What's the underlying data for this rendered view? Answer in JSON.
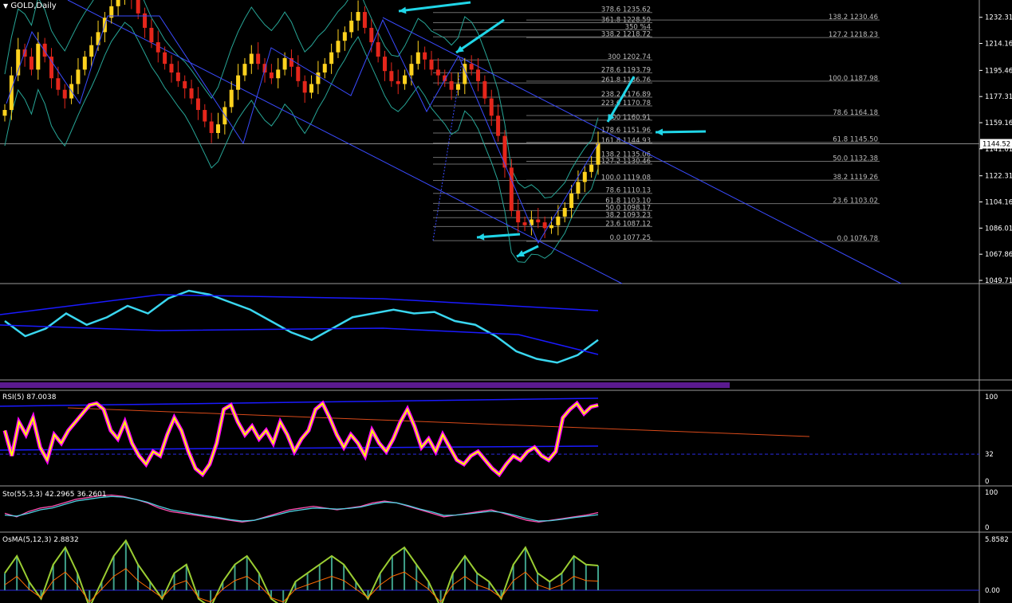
{
  "window": {
    "title": "GOLD,Daily",
    "menu_icon": "triangle-down-icon"
  },
  "colors": {
    "background": "#000000",
    "bull_candle": "#ffd21e",
    "bear_candle": "#e5261b",
    "bollinger": "#27a596",
    "trendline": "#3a4bff",
    "arrow": "#20d6e8",
    "fib_line": "#6e6e6e",
    "rsi_main": "#ffff00",
    "rsi_glow": "#ff00ff",
    "osma_bars": "#9acd32",
    "osma_signal": "#ff6a00"
  },
  "chart_data": [
    {
      "type": "candlestick",
      "title": "GOLD,Daily",
      "symbol": "GOLD",
      "timeframe": "Daily",
      "ylim": [
        1049.71,
        1241.0
      ],
      "y_tick_labels": [
        "1232.31",
        "1214.16",
        "1195.46",
        "1177.31",
        "1159.16",
        "1141.01",
        "1122.31",
        "1104.16",
        "1086.01",
        "1067.86",
        "1049.71"
      ],
      "current_price": "1144.52",
      "closes": [
        1168,
        1192,
        1210,
        1205,
        1196,
        1214,
        1205,
        1190,
        1182,
        1176,
        1186,
        1196,
        1205,
        1213,
        1222,
        1232,
        1240,
        1245,
        1250,
        1245,
        1235,
        1225,
        1215,
        1208,
        1200,
        1194,
        1188,
        1183,
        1176,
        1168,
        1160,
        1152,
        1158,
        1170,
        1182,
        1192,
        1200,
        1207,
        1200,
        1194,
        1190,
        1196,
        1204,
        1198,
        1188,
        1180,
        1186,
        1194,
        1200,
        1208,
        1216,
        1222,
        1230,
        1236,
        1225,
        1215,
        1205,
        1195,
        1188,
        1186,
        1192,
        1200,
        1208,
        1203,
        1196,
        1192,
        1188,
        1182,
        1186,
        1200,
        1196,
        1188,
        1176,
        1164,
        1150,
        1128,
        1098,
        1090,
        1088,
        1092,
        1090,
        1086,
        1088,
        1094,
        1100,
        1110,
        1118,
        1125,
        1130,
        1145
      ],
      "fib_retracement_left": [
        {
          "level": "378.6 1235.62",
          "price": 1235.62
        },
        {
          "level": "361.8 1228.59",
          "price": 1228.59
        },
        {
          "level": "350 %4",
          "price": 1223.6
        },
        {
          "level": "338.2 1218.72",
          "price": 1218.72
        },
        {
          "level": "300 1202.74",
          "price": 1202.74
        },
        {
          "level": "278.6 1193.79",
          "price": 1193.79
        },
        {
          "level": "261.8 1186.76",
          "price": 1186.76
        },
        {
          "level": "238.2 1176.89",
          "price": 1176.89
        },
        {
          "level": "223.6 1170.78",
          "price": 1170.78
        },
        {
          "level": "200 1160.91",
          "price": 1160.91
        },
        {
          "level": "178.6 1151.96",
          "price": 1151.96
        },
        {
          "level": "161.8 1144.93",
          "price": 1144.93
        },
        {
          "level": "138.2 1135.06",
          "price": 1135.06
        },
        {
          "level": "127.2 1130.46",
          "price": 1130.46
        },
        {
          "level": "100.0 1119.08",
          "price": 1119.08
        },
        {
          "level": "78.6 1110.13",
          "price": 1110.13
        },
        {
          "level": "61.8 1103.10",
          "price": 1103.1
        },
        {
          "level": "50.0 1098.17",
          "price": 1098.17
        },
        {
          "level": "38.2 1093.23",
          "price": 1093.23
        },
        {
          "level": "23.6 1087.12",
          "price": 1087.12
        },
        {
          "level": "0.0 1077.25",
          "price": 1077.25
        }
      ],
      "fib_retracement_right": [
        {
          "level": "138.2 1230.46",
          "price": 1230.46
        },
        {
          "level": "127.2 1218.23",
          "price": 1218.23
        },
        {
          "level": "100.0 1187.98",
          "price": 1187.98
        },
        {
          "level": "78.6 1164.18",
          "price": 1164.18
        },
        {
          "level": "61.8 1145.50",
          "price": 1145.5
        },
        {
          "level": "50.0 1132.38",
          "price": 1132.38
        },
        {
          "level": "38.2 1119.26",
          "price": 1119.26
        },
        {
          "level": "23.6 1103.02",
          "price": 1103.02
        },
        {
          "level": "0.0 1076.78",
          "price": 1076.78
        }
      ]
    },
    {
      "type": "line",
      "title": "",
      "series": [
        {
          "values": [
            0.6,
            0.4,
            0.5,
            0.7,
            0.55,
            0.65,
            0.8,
            0.7,
            0.9,
            1.0,
            0.95,
            0.85,
            0.75,
            0.6,
            0.45,
            0.35,
            0.5,
            0.65,
            0.7,
            0.75,
            0.7,
            0.72,
            0.6,
            0.55,
            0.4,
            0.2,
            0.1,
            0.05,
            0.15,
            0.35
          ]
        }
      ]
    },
    {
      "type": "line",
      "title": "RSI(5) 87.0038",
      "ylim": [
        0,
        100
      ],
      "y_tick_labels": [
        "100",
        "32",
        "0"
      ],
      "level": 32,
      "series": [
        {
          "name": "RSI(5) 87.0038",
          "values": [
            60,
            30,
            70,
            55,
            75,
            40,
            25,
            55,
            45,
            60,
            70,
            80,
            90,
            92,
            85,
            60,
            50,
            70,
            45,
            30,
            20,
            35,
            30,
            55,
            75,
            60,
            35,
            15,
            8,
            20,
            45,
            85,
            90,
            70,
            55,
            65,
            50,
            60,
            45,
            70,
            55,
            35,
            50,
            60,
            85,
            92,
            75,
            55,
            40,
            55,
            45,
            30,
            60,
            45,
            35,
            50,
            70,
            85,
            65,
            40,
            50,
            35,
            55,
            40,
            25,
            20,
            30,
            35,
            25,
            15,
            8,
            20,
            30,
            25,
            35,
            40,
            30,
            25,
            35,
            75,
            85,
            92,
            80,
            88,
            90
          ]
        }
      ]
    },
    {
      "type": "line",
      "title": "Sto(55,3,3) 42.2965 36.2601",
      "ylim": [
        0,
        100
      ],
      "y_tick_labels": [
        "100",
        "0"
      ],
      "series": [
        {
          "name": "42.2965",
          "values": [
            40,
            30,
            45,
            55,
            60,
            70,
            80,
            85,
            90,
            92,
            88,
            80,
            70,
            55,
            45,
            40,
            35,
            30,
            25,
            20,
            15,
            20,
            30,
            40,
            50,
            55,
            60,
            55,
            50,
            55,
            60,
            70,
            75,
            70,
            60,
            50,
            40,
            30,
            35,
            40,
            45,
            50,
            40,
            30,
            20,
            15,
            20,
            25,
            30,
            35,
            42
          ]
        },
        {
          "name": "36.2601",
          "values": [
            35,
            32,
            40,
            50,
            55,
            65,
            75,
            80,
            85,
            88,
            86,
            80,
            72,
            60,
            50,
            44,
            38,
            33,
            28,
            22,
            18,
            20,
            28,
            36,
            45,
            50,
            55,
            54,
            52,
            54,
            58,
            66,
            72,
            70,
            62,
            52,
            44,
            34,
            35,
            38,
            42,
            46,
            42,
            34,
            25,
            18,
            19,
            23,
            28,
            32,
            36
          ]
        }
      ]
    },
    {
      "type": "bar",
      "title": "OsMA(5,12,3) 2.8832",
      "y_tick_labels": [
        "5.8582",
        "0.00"
      ],
      "values": [
        2,
        4,
        1,
        -1,
        3,
        5,
        2,
        -2,
        1,
        4,
        5.8,
        3,
        1,
        -1,
        2,
        3,
        -1,
        -2,
        1,
        3,
        4,
        2,
        -1,
        -2,
        1,
        2,
        3,
        4,
        3,
        1,
        -1,
        2,
        4,
        5,
        3,
        1,
        -2,
        2,
        4,
        2,
        1,
        -1,
        3,
        5,
        2,
        1,
        2,
        4,
        3,
        2.88
      ]
    }
  ]
}
